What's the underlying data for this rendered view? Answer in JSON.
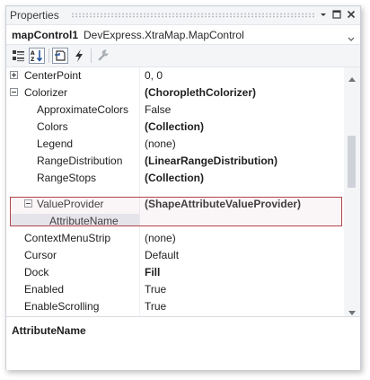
{
  "window": {
    "title": "Properties"
  },
  "object_selector": {
    "name": "mapControl1",
    "type": "DevExpress.XtraMap.MapControl"
  },
  "toolbar": {
    "buttons": [
      "categorized-icon",
      "alphabetical-icon",
      "property-pages-icon",
      "events-icon",
      "wrench-icon"
    ],
    "selected": "alphabetical"
  },
  "properties": [
    {
      "name": "CenterPoint",
      "value": "0, 0",
      "bold": false,
      "level": 0,
      "expander": "plus"
    },
    {
      "name": "Colorizer",
      "value": "(ChoroplethColorizer)",
      "bold": true,
      "level": 0,
      "expander": "minus"
    },
    {
      "name": "ApproximateColors",
      "value": "False",
      "bold": false,
      "level": 1,
      "expander": ""
    },
    {
      "name": "Colors",
      "value": "(Collection)",
      "bold": true,
      "level": 1,
      "expander": ""
    },
    {
      "name": "Legend",
      "value": "(none)",
      "bold": false,
      "level": 1,
      "expander": ""
    },
    {
      "name": "RangeDistribution",
      "value": "(LinearRangeDistribution)",
      "bold": true,
      "level": 1,
      "expander": ""
    },
    {
      "name": "RangeStops",
      "value": "(Collection)",
      "bold": true,
      "level": 1,
      "expander": ""
    },
    {
      "name": "ValueProvider",
      "value": "(ShapeAttributeValueProvider)",
      "bold": true,
      "level": 1,
      "expander": "minus"
    },
    {
      "name": "AttributeName",
      "value": "",
      "bold": false,
      "level": 2,
      "expander": ""
    },
    {
      "name": "ContextMenuStrip",
      "value": "(none)",
      "bold": false,
      "level": 0,
      "expander": ""
    },
    {
      "name": "Cursor",
      "value": "Default",
      "bold": false,
      "level": 0,
      "expander": ""
    },
    {
      "name": "Dock",
      "value": "Fill",
      "bold": true,
      "level": 0,
      "expander": ""
    },
    {
      "name": "Enabled",
      "value": "True",
      "bold": false,
      "level": 0,
      "expander": ""
    },
    {
      "name": "EnableScrolling",
      "value": "True",
      "bold": false,
      "level": 0,
      "expander": ""
    }
  ],
  "selected_property": "AttributeName",
  "description": {
    "title": "AttributeName"
  },
  "colors": {
    "highlight_border": "#b5434a",
    "selection": "#e6e9ef"
  }
}
